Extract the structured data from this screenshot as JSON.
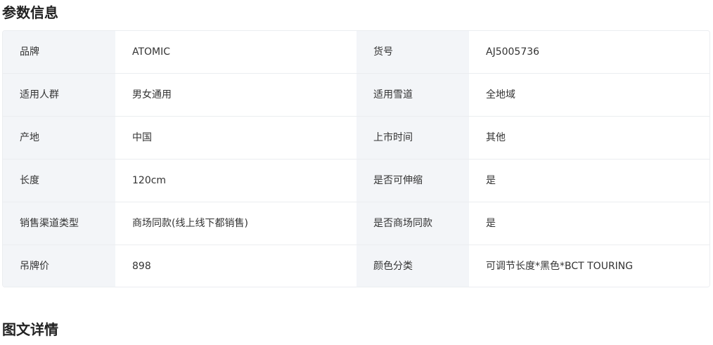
{
  "sections": {
    "params_title": "参数信息",
    "details_title": "图文详情"
  },
  "params": [
    {
      "label1": "品牌",
      "value1": "ATOMIC",
      "label2": "货号",
      "value2": "AJ5005736"
    },
    {
      "label1": "适用人群",
      "value1": "男女通用",
      "label2": "适用雪道",
      "value2": "全地域"
    },
    {
      "label1": "产地",
      "value1": "中国",
      "label2": "上市时间",
      "value2": "其他"
    },
    {
      "label1": "长度",
      "value1": "120cm",
      "label2": "是否可伸缩",
      "value2": "是"
    },
    {
      "label1": "销售渠道类型",
      "value1": "商场同款(线上线下都销售)",
      "label2": "是否商场同款",
      "value2": "是"
    },
    {
      "label1": "吊牌价",
      "value1": "898",
      "label2": "颜色分类",
      "value2": "可调节长度*黑色*BCT TOURING"
    }
  ]
}
